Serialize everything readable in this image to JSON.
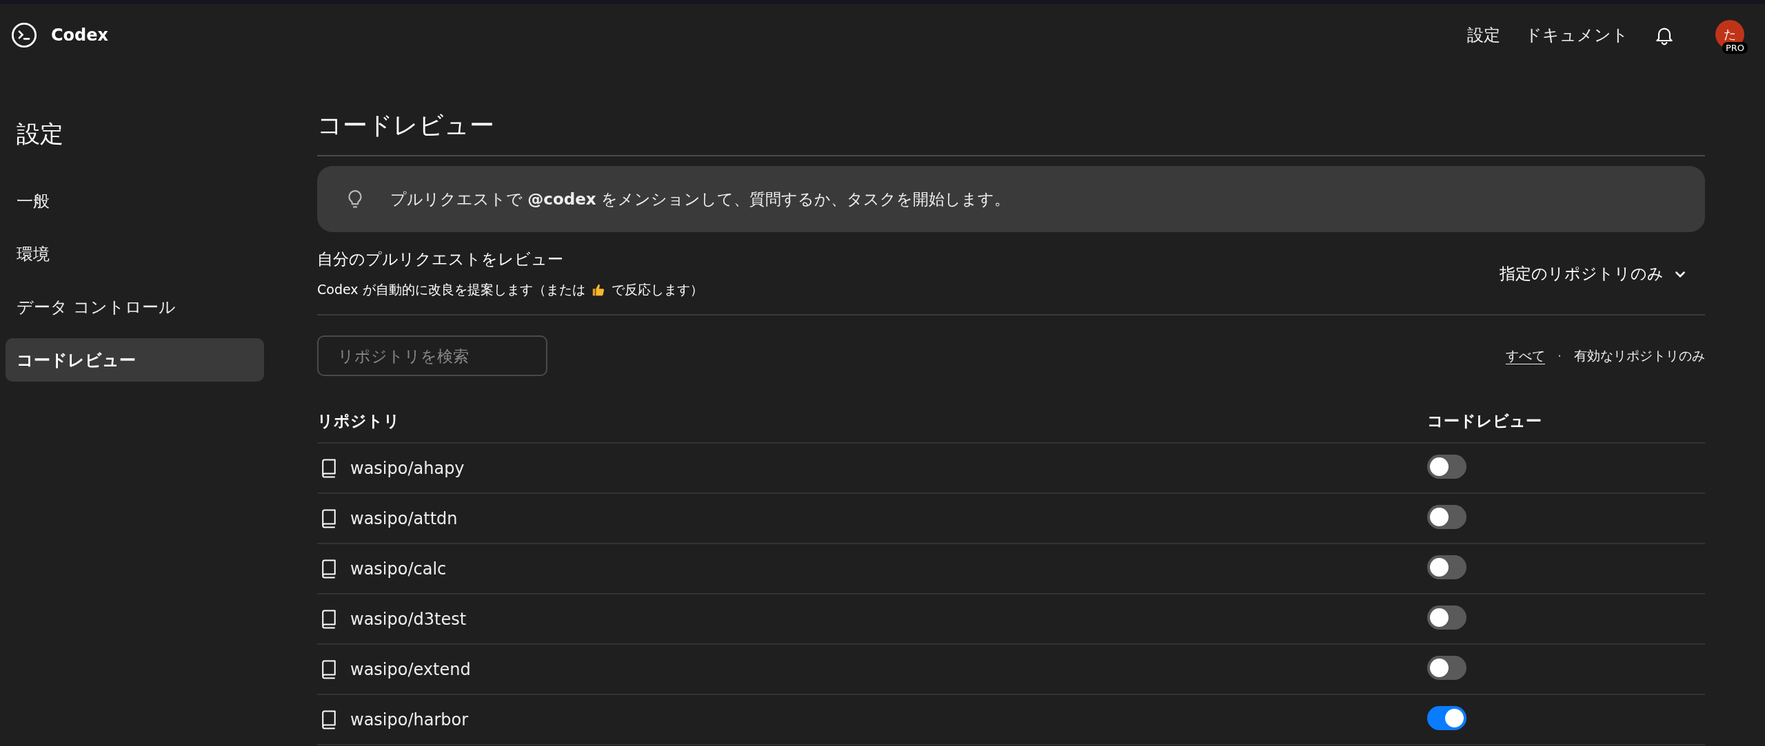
{
  "header": {
    "brand": "Codex",
    "nav": [
      "設定",
      "ドキュメント"
    ],
    "avatar": {
      "initial": "た",
      "badge": "PRO"
    }
  },
  "sidebar": {
    "title": "設定",
    "items": [
      {
        "label": "一般",
        "selected": false
      },
      {
        "label": "環境",
        "selected": false
      },
      {
        "label": "データ コントロール",
        "selected": false
      },
      {
        "label": "コードレビュー",
        "selected": true
      }
    ]
  },
  "page": {
    "title": "コードレビュー",
    "banner": "プルリクエストで **@codex** をメンションして、質問するか、タスクを開始します。",
    "section": {
      "title": "自分のプルリクエストをレビュー",
      "description_before": "Codex が自動的に改良を提案します（または",
      "description_after": "で反応します）",
      "dropdown": "指定のリポジトリのみ"
    },
    "search": {
      "placeholder": "リポジトリを検索"
    },
    "filters": [
      {
        "label": "すべて",
        "selected": true
      },
      {
        "label": "有効なリポジトリのみ",
        "selected": false
      }
    ],
    "filter_separator": "·",
    "table": {
      "columns": [
        "リポジトリ",
        "コードレビュー"
      ],
      "rows": [
        {
          "name": "wasipo/ahapy",
          "on": false
        },
        {
          "name": "wasipo/attdn",
          "on": false
        },
        {
          "name": "wasipo/calc",
          "on": false
        },
        {
          "name": "wasipo/d3test",
          "on": false
        },
        {
          "name": "wasipo/extend",
          "on": false
        },
        {
          "name": "wasipo/harbor",
          "on": true
        }
      ]
    }
  }
}
